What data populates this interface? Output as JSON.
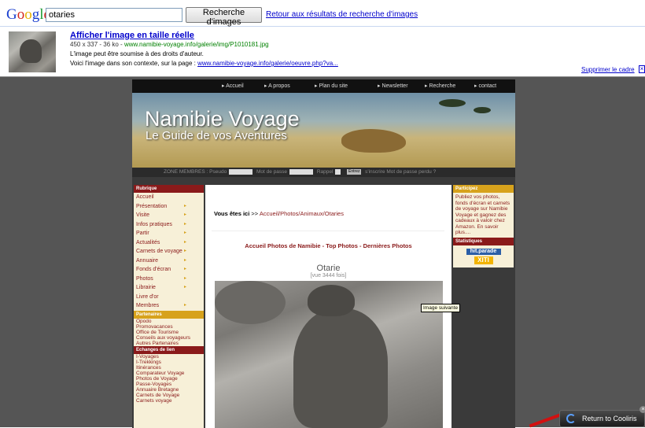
{
  "google": {
    "logo": "Google",
    "search_value": "otaries",
    "search_button": "Recherche d'images",
    "back_link": "Retour aux résultats de recherche d'images",
    "title_link": "Afficher l'image en taille réelle",
    "meta_size": "450 x 337 - 36 ko - ",
    "meta_url": "www.namibie-voyage.info/galerie/img/P1010181.jpg",
    "rights": "L'image peut être soumise à des droits d'auteur.",
    "context_prefix": "Voici l'image dans son contexte, sur la page : ",
    "context_url": "www.namibie-voyage.info/galerie/oeuvre.php?va...",
    "remove_frame": "Supprimer le cadre",
    "remove_x": "×"
  },
  "site": {
    "nav": [
      "Accueil",
      "A propos",
      "Plan du site",
      "Newsletter",
      "Recherche",
      "contact"
    ],
    "title": "Namibie Voyage",
    "subtitle": "Le Guide de vos Aventures",
    "members_label": "ZONE MEMBRES : Pseudo",
    "members_pass": "Mot de passe",
    "members_recall": "Rappel",
    "members_button": "Entrez",
    "members_links": "s'inscrire  Mot de passe perdu ?",
    "left_heading": "Rubrique",
    "left_menu": [
      "Accueil",
      "Présentation",
      "Visite",
      "Infos pratiques",
      "Partir",
      "Actualités",
      "Carnets de voyage",
      "Annuaire",
      "Fonds d'écran",
      "Photos",
      "Librairie",
      "Livre d'or",
      "Membres"
    ],
    "partners_heading": "Partenaires",
    "partners": [
      "Opodo",
      "Promovacances",
      "Office de Tourisme",
      "Conseils aux voyageurs",
      "Autres Partenaires"
    ],
    "links_heading": "Echanges de lien",
    "links": [
      "I-Voyages",
      "I-Trekkings",
      "Itinérances",
      "Comparateur Voyage",
      "Photos de Voyage",
      "Passe-Voyages",
      "Annuaire Bretagne",
      "Carnets de Voyage",
      "Carnets voyage"
    ],
    "breadcrumb_bold": "Vous êtes ici",
    "breadcrumb_sep": " >> ",
    "breadcrumb_path": "Accueil/Photos/Animaux/Otaries",
    "gallery_title": "Accueil Photos de Namibie - Top Photos - Dernières Photos",
    "photo_title": "Otarie",
    "photo_views": "[vue 3444 fois]",
    "tooltip": "Image suivante",
    "right_heading": "Participez",
    "right_text": "Publiez vos photos, fonds d'écran et carnets de voyage sur Namibie Voyage et gagnez des cadeaux à valoir chez Amazon. En savoir plus....",
    "stats_heading": "Statistiques",
    "stats_logo1": "hit.parade",
    "stats_logo2": "XITI"
  },
  "cooliris": {
    "label": "Return to Cooliris",
    "close": "×"
  }
}
